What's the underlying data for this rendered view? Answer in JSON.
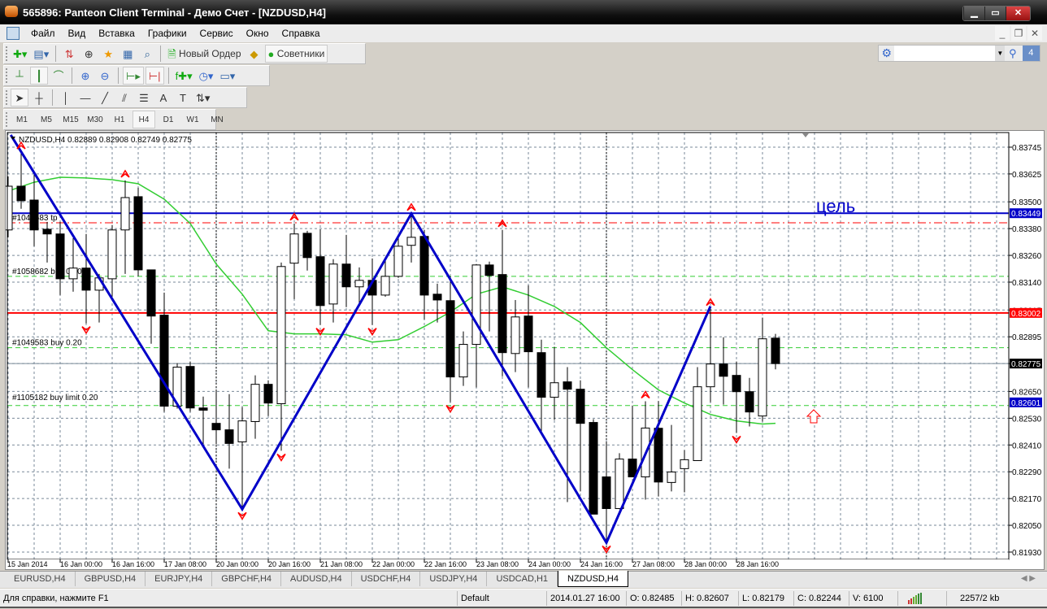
{
  "window": {
    "title": "565896: Panteon Client Terminal - Демо Счет - [NZDUSD,H4]"
  },
  "menu": [
    "Файл",
    "Вид",
    "Вставка",
    "Графики",
    "Сервис",
    "Окно",
    "Справка"
  ],
  "toolbar": {
    "new_order": "Новый Ордер",
    "experts": "Советники",
    "search_placeholder": "",
    "notifications_count": "4"
  },
  "timeframes": [
    "M1",
    "M5",
    "M15",
    "M30",
    "H1",
    "H4",
    "D1",
    "W1",
    "MN"
  ],
  "active_timeframe": "H4",
  "chart": {
    "header": "NZDUSD,H4  0.82889 0.82908 0.82749 0.82775",
    "annotation": "цель",
    "colors": {
      "bull": "#ffffff",
      "bear": "#000000",
      "ma": "#32cd32",
      "zigzag": "#0000c8",
      "grid": "#7a8a99",
      "marker": "#ff0000"
    },
    "price_ticks": [
      "0.83745",
      "0.83625",
      "0.83500",
      "0.83380",
      "0.83260",
      "0.83140",
      "0.83015",
      "0.82895",
      "0.82775",
      "0.82650",
      "0.82530",
      "0.82410",
      "0.82290",
      "0.82170",
      "0.82050",
      "0.81930"
    ],
    "price_boxes": [
      {
        "value": "0.83449",
        "color": "#0000c8"
      },
      {
        "value": "0.83002",
        "color": "#ff0000"
      },
      {
        "value": "0.82775",
        "color": "#000000"
      },
      {
        "value": "0.82601",
        "color": "#0000c8"
      }
    ],
    "time_labels": [
      "15 Jan 2014",
      "16 Jan 00:00",
      "16 Jan 16:00",
      "17 Jan 08:00",
      "20 Jan 00:00",
      "20 Jan 16:00",
      "21 Jan 08:00",
      "22 Jan 00:00",
      "22 Jan 16:00",
      "23 Jan 08:00",
      "24 Jan 00:00",
      "24 Jan 16:00",
      "27 Jan 08:00",
      "28 Jan 00:00",
      "28 Jan 16:00"
    ],
    "order_lines": [
      {
        "label": "#1049583 tp",
        "price": 0.83406,
        "color": "#ff0000",
        "style": "dashdot"
      },
      {
        "label": "#1058682 buy 0.20",
        "price": 0.83166,
        "color": "#32cd32",
        "style": "dash"
      },
      {
        "label": "#1049583 buy 0.20",
        "price": 0.82846,
        "color": "#32cd32",
        "style": "dash"
      },
      {
        "label": "#1105182 buy limit 0.20",
        "price": 0.82601,
        "color": "#0000c8",
        "style": "solid"
      }
    ],
    "hlines": [
      {
        "price": 0.83449,
        "color": "#0000c8",
        "width": 2
      },
      {
        "price": 0.83002,
        "color": "#ff0000",
        "width": 2
      },
      {
        "price": 0.82775,
        "color": "#7a8a99",
        "width": 1
      },
      {
        "price": 0.82587,
        "color": "#32cd32",
        "width": 1,
        "dash": true
      }
    ],
    "candles": [
      [
        0.83374,
        0.83614,
        0.83341,
        0.8357
      ],
      [
        0.8357,
        0.83723,
        0.83469,
        0.83505
      ],
      [
        0.83508,
        0.83621,
        0.83301,
        0.83374
      ],
      [
        0.83377,
        0.8341,
        0.83228,
        0.83356
      ],
      [
        0.83356,
        0.8341,
        0.83082,
        0.83155
      ],
      [
        0.83155,
        0.83337,
        0.83097,
        0.83203
      ],
      [
        0.83203,
        0.83356,
        0.82955,
        0.83104
      ],
      [
        0.83104,
        0.83177,
        0.82959,
        0.83159
      ],
      [
        0.83155,
        0.83396,
        0.83075,
        0.83374
      ],
      [
        0.83374,
        0.83596,
        0.83177,
        0.83519
      ],
      [
        0.83523,
        0.83563,
        0.83166,
        0.83195
      ],
      [
        0.83195,
        0.83195,
        0.82864,
        0.82988
      ],
      [
        0.82992,
        0.83093,
        0.82558,
        0.82584
      ],
      [
        0.82584,
        0.82777,
        0.82573,
        0.82759
      ],
      [
        0.82762,
        0.82784,
        0.82558,
        0.82576
      ],
      [
        0.82576,
        0.82627,
        0.82409,
        0.82566
      ],
      [
        0.82507,
        0.82657,
        0.82413,
        0.82478
      ],
      [
        0.82478,
        0.82638,
        0.82304,
        0.82417
      ],
      [
        0.82424,
        0.8258,
        0.82122,
        0.82518
      ],
      [
        0.82515,
        0.82722,
        0.82438,
        0.82682
      ],
      [
        0.82682,
        0.827,
        0.8254,
        0.82598
      ],
      [
        0.82595,
        0.83228,
        0.82384,
        0.8321
      ],
      [
        0.83225,
        0.83403,
        0.83064,
        0.83356
      ],
      [
        0.83359,
        0.8337,
        0.83192,
        0.8325
      ],
      [
        0.83254,
        0.83377,
        0.82948,
        0.83035
      ],
      [
        0.83042,
        0.83243,
        0.82959,
        0.83221
      ],
      [
        0.83221,
        0.83352,
        0.83028,
        0.83119
      ],
      [
        0.83119,
        0.83206,
        0.83046,
        0.83148
      ],
      [
        0.83148,
        0.83246,
        0.82948,
        0.83082
      ],
      [
        0.83082,
        0.8325,
        0.83075,
        0.83166
      ],
      [
        0.83166,
        0.83337,
        0.83159,
        0.83301
      ],
      [
        0.83305,
        0.83447,
        0.83228,
        0.83341
      ],
      [
        0.83345,
        0.83374,
        0.82973,
        0.83082
      ],
      [
        0.83086,
        0.83133,
        0.82959,
        0.8306
      ],
      [
        0.83057,
        0.83166,
        0.82602,
        0.82715
      ],
      [
        0.82715,
        0.82919,
        0.82675,
        0.82861
      ],
      [
        0.82861,
        0.83221,
        0.82668,
        0.83217
      ],
      [
        0.83217,
        0.83232,
        0.82919,
        0.8317
      ],
      [
        0.83174,
        0.83374,
        0.82718,
        0.82824
      ],
      [
        0.8282,
        0.8306,
        0.82737,
        0.82984
      ],
      [
        0.82988,
        0.83126,
        0.82668,
        0.82828
      ],
      [
        0.82824,
        0.82882,
        0.82464,
        0.82624
      ],
      [
        0.82624,
        0.8285,
        0.82522,
        0.82689
      ],
      [
        0.82693,
        0.82759,
        0.82154,
        0.8266
      ],
      [
        0.8266,
        0.827,
        0.82202,
        0.82507
      ],
      [
        0.82511,
        0.82526,
        0.821,
        0.821
      ],
      [
        0.82267,
        0.8242,
        0.81972,
        0.82125
      ],
      [
        0.82125,
        0.82373,
        0.82122,
        0.82347
      ],
      [
        0.82347,
        0.82587,
        0.82267,
        0.82267
      ],
      [
        0.82267,
        0.82606,
        0.82165,
        0.82486
      ],
      [
        0.82485,
        0.82607,
        0.82179,
        0.82244
      ],
      [
        0.82242,
        0.825,
        0.82202,
        0.82289
      ],
      [
        0.82304,
        0.82387,
        0.82198,
        0.82344
      ],
      [
        0.8234,
        0.82759,
        0.8234,
        0.82671
      ],
      [
        0.82671,
        0.83021,
        0.82602,
        0.82773
      ],
      [
        0.82773,
        0.82893,
        0.82591,
        0.82718
      ],
      [
        0.82722,
        0.82784,
        0.82464,
        0.82649
      ],
      [
        0.82649,
        0.82711,
        0.82493,
        0.82558
      ],
      [
        0.8254,
        0.82981,
        0.82515,
        0.82886
      ],
      [
        0.82889,
        0.82908,
        0.82749,
        0.82775
      ]
    ],
    "ma": [
      [
        0,
        0.83548
      ],
      [
        2,
        0.83588
      ],
      [
        4,
        0.8361
      ],
      [
        6,
        0.83607
      ],
      [
        8,
        0.83599
      ],
      [
        10,
        0.83581
      ],
      [
        12,
        0.83512
      ],
      [
        14,
        0.83403
      ],
      [
        16,
        0.83221
      ],
      [
        18,
        0.83086
      ],
      [
        20,
        0.82922
      ],
      [
        22,
        0.82908
      ],
      [
        24,
        0.82908
      ],
      [
        26,
        0.82904
      ],
      [
        28,
        0.82871
      ],
      [
        30,
        0.82882
      ],
      [
        32,
        0.82941
      ],
      [
        34,
        0.83006
      ],
      [
        36,
        0.83086
      ],
      [
        38,
        0.83119
      ],
      [
        40,
        0.83082
      ],
      [
        42,
        0.83031
      ],
      [
        44,
        0.82959
      ],
      [
        46,
        0.82846
      ],
      [
        48,
        0.82748
      ],
      [
        50,
        0.82657
      ],
      [
        52,
        0.82598
      ],
      [
        54,
        0.82547
      ],
      [
        56,
        0.82518
      ],
      [
        58,
        0.82504
      ],
      [
        59,
        0.82507
      ]
    ],
    "zigzag": [
      [
        0.2,
        0.838
      ],
      [
        18,
        0.82122
      ],
      [
        31,
        0.83447
      ],
      [
        46,
        0.81972
      ],
      [
        54,
        0.83032
      ]
    ],
    "fractals_up": [
      1,
      9,
      22,
      31,
      38,
      49,
      54
    ],
    "fractals_down": [
      6,
      18,
      21,
      24,
      28,
      34,
      46,
      56
    ]
  },
  "tabs": [
    "EURUSD,H4",
    "GBPUSD,H4",
    "EURJPY,H4",
    "GBPCHF,H4",
    "AUDUSD,H4",
    "USDCHF,H4",
    "USDJPY,H4",
    "USDCAD,H1",
    "NZDUSD,H4"
  ],
  "active_tab": "NZDUSD,H4",
  "status": {
    "help": "Для справки, нажмите F1",
    "profile": "Default",
    "time": "2014.01.27 16:00",
    "open": "O: 0.82485",
    "high": "H: 0.82607",
    "low": "L: 0.82179",
    "close": "C: 0.82244",
    "volume": "V: 6100",
    "traffic": "2257/2 kb"
  }
}
